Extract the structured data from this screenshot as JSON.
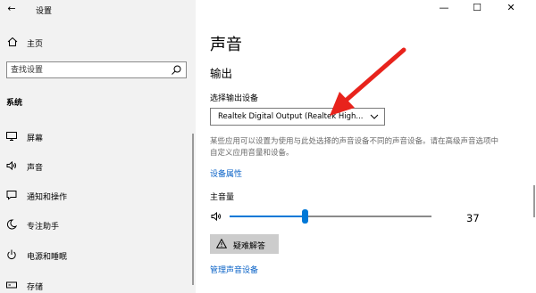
{
  "window": {
    "title": "设置",
    "back_icon": "back-arrow-icon",
    "controls": [
      "minimize-icon",
      "maximize-icon",
      "close-icon"
    ]
  },
  "sidebar": {
    "home_label": "主页",
    "search_placeholder": "查找设置",
    "section_title": "系统",
    "items": [
      {
        "label": "屏幕",
        "icon": "monitor-icon"
      },
      {
        "label": "声音",
        "icon": "speaker-icon"
      },
      {
        "label": "通知和操作",
        "icon": "notification-icon"
      },
      {
        "label": "专注助手",
        "icon": "moon-icon"
      },
      {
        "label": "电源和睡眠",
        "icon": "power-icon"
      },
      {
        "label": "存储",
        "icon": "storage-icon"
      }
    ]
  },
  "main": {
    "title": "声音",
    "output_heading": "输出",
    "device_label": "选择输出设备",
    "device_selected": "Realtek Digital Output (Realtek High...",
    "description": "某些应用可以设置为使用与此处选择的声音设备不同的声音设备。请在高级声音选项中自定义应用音量和设备。",
    "device_properties_link": "设备属性",
    "volume_label": "主音量",
    "volume_value": "37",
    "volume_level": 0.37,
    "troubleshoot_label": "疑难解答",
    "manage_devices_link": "管理声音设备"
  },
  "colors": {
    "accent": "#0078d7",
    "link": "#0b63c7",
    "sidebar_bg": "#f2f2f2",
    "annotation_arrow": "#e8231c"
  }
}
